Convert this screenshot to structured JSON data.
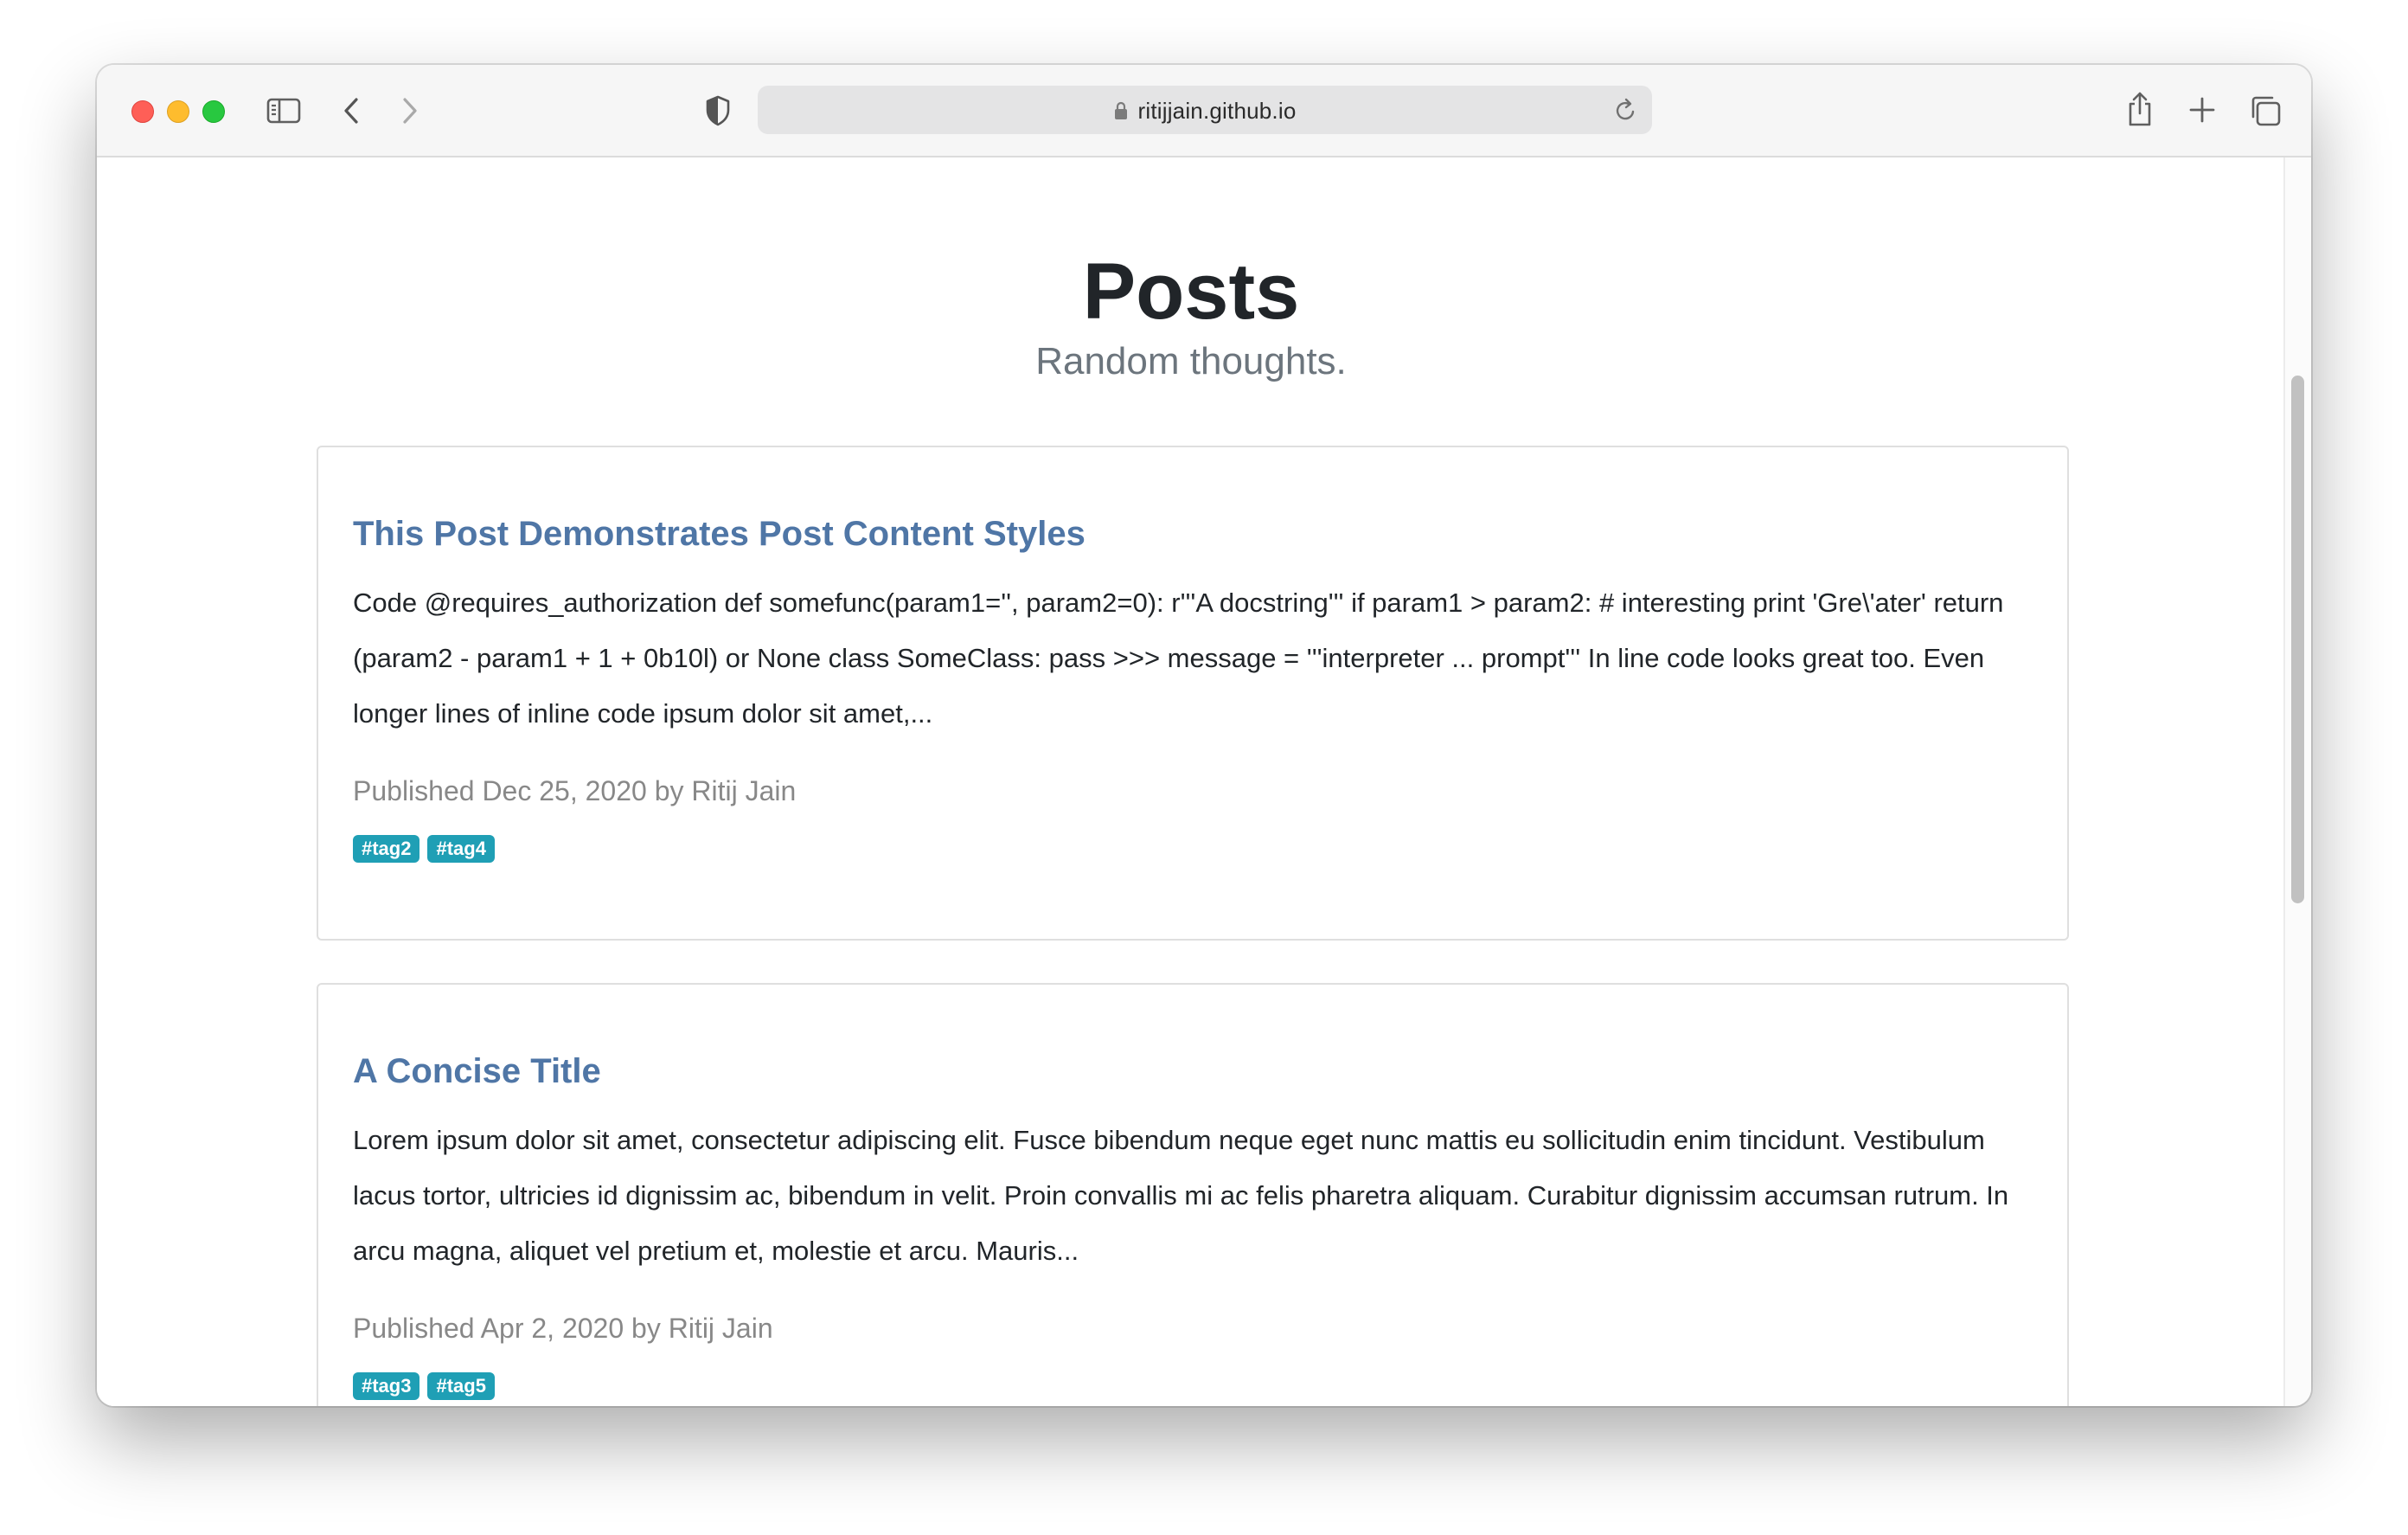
{
  "browser": {
    "url": "ritijjain.github.io"
  },
  "page": {
    "title": "Posts",
    "subtitle": "Random thoughts."
  },
  "posts": [
    {
      "title": "This Post Demonstrates Post Content Styles",
      "excerpt": "Code @requires_authorization def somefunc(param1='', param2=0): r'''A docstring''' if param1 > param2: # interesting print 'Gre\\'ater' return (param2 - param1 + 1 + 0b10l) or None class SomeClass: pass >>> message = '''interpreter ... prompt''' In line code looks great too. Even longer lines of inline code ipsum dolor sit amet,...",
      "meta": "Published Dec 25, 2020 by Ritij Jain",
      "tags": [
        "#tag2",
        "#tag4"
      ]
    },
    {
      "title": "A Concise Title",
      "excerpt": "Lorem ipsum dolor sit amet, consectetur adipiscing elit. Fusce bibendum neque eget nunc mattis eu sollicitudin enim tincidunt. Vestibulum lacus tortor, ultricies id dignissim ac, bibendum in velit. Proin convallis mi ac felis pharetra aliquam. Curabitur dignissim accumsan rutrum. In arcu magna, aliquet vel pretium et, molestie et arcu. Mauris...",
      "meta": "Published Apr 2, 2020 by Ritij Jain",
      "tags": [
        "#tag3",
        "#tag5"
      ]
    }
  ],
  "colors": {
    "link": "#4f76a6",
    "tag": "#1f9fb5",
    "muted": "#6c757d"
  }
}
